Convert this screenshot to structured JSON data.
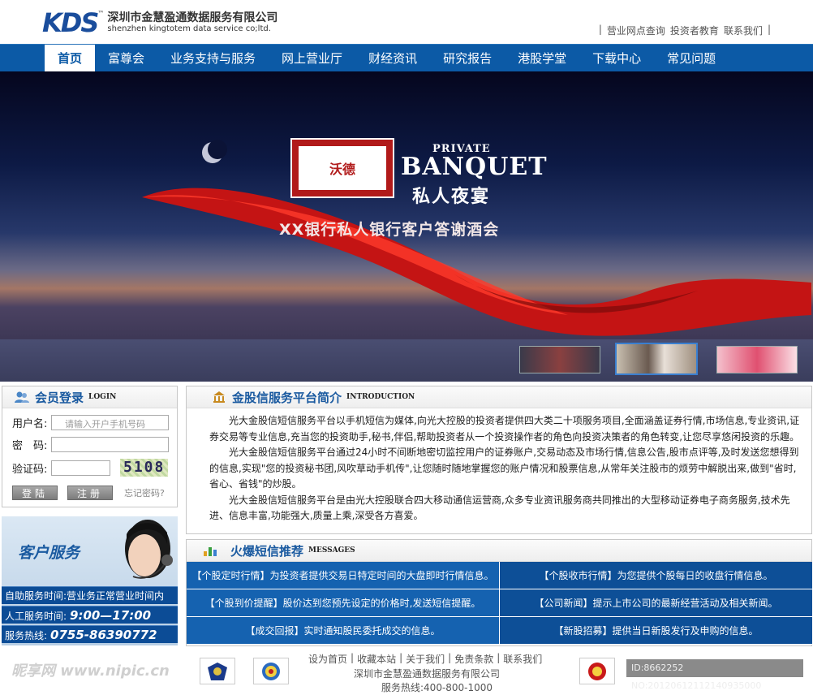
{
  "header": {
    "logo_mark": "KDS",
    "logo_tm": "™",
    "company_cn": "深圳市金慧盈通数据服务有限公司",
    "company_en": "shenzhen kingtotem data service co;ltd.",
    "toplinks": [
      "|",
      "营业网点查询",
      "投资者教育",
      "联系我们",
      "|"
    ]
  },
  "nav": {
    "items": [
      "首页",
      "富尊会",
      "业务支持与服务",
      "网上营业厅",
      "财经资讯",
      "研究报告",
      "港股学堂",
      "下载中心",
      "常见问题"
    ],
    "active_index": 0
  },
  "banner": {
    "brand": "沃德",
    "private": "PRIVATE",
    "banquet": "BANQUET",
    "night": "私人夜宴",
    "slogan": "XX银行私人银行客户答谢酒会"
  },
  "login": {
    "title": "会员登录",
    "title_en": "LOGIN",
    "username_label": "用户名:",
    "username_placeholder": "请输入开户手机号码",
    "password_label": "密　码:",
    "captcha_label": "验证码:",
    "captcha_value": "5108",
    "login_button": "登陆",
    "register_button": "注册",
    "forgot": "忘记密码?"
  },
  "service": {
    "title": "客户服务",
    "hours_label": "自助服务时间:",
    "hours_value": "营业务正常营业时间内",
    "manual_label": "人工服务时间:",
    "manual_value": "9:00—17:00",
    "hotline_label": "服务热线:",
    "hotline_value": "0755-86390772"
  },
  "intro": {
    "title": "金股信服务平台简介",
    "title_en": "INTRODUCTION",
    "paragraphs": [
      "光大金股信短信服务平台以手机短信为媒体,向光大控股的投资者提供四大类二十项服务项目,全面涵盖证券行情,市场信息,专业资讯,证券交易等专业信息,充当您的投资助手,秘书,伴侣,帮助投资者从一个投资操作者的角色向投资决策者的角色转变,让您尽享悠闲投资的乐趣。",
      "光大金股信短信服务平台通过24小时不间断地密切监控用户的证券账户,交易动态及市场行情,信息公告,股市点评等,及时发送您想得到的信息,实现\"您的投资秘书团,风吹草动手机传\",让您随时随地掌握您的账户情况和股票信息,从常年关注股市的烦劳中解脱出来,做到\"省时,省心、省钱\"的炒股。",
      "光大金股信短信服务平台是由光大控股联合四大移动通信运营商,众多专业资讯服务商共同推出的大型移动证券电子商务服务,技术先进、信息丰富,功能强大,质量上乘,深受各方喜爱。"
    ]
  },
  "messages": {
    "title": "火爆短信推荐",
    "title_en": "MESSAGES",
    "items": [
      "【个股定时行情】为投资者提供交易日特定时间的大盘即时行情信息。",
      "【个股收市行情】为您提供个股每日的收盘行情信息。",
      "【个股到价提醒】股价达到您预先设定的价格时,发送短信提醒。",
      "【公司新闻】提示上市公司的最新经营活动及相关新闻。",
      "【成交回报】实时通知股民委托成交的信息。",
      "【新股招募】提供当日新股发行及申购的信息。"
    ]
  },
  "footer": {
    "links": [
      "设为首页",
      "|",
      "收藏本站",
      "|",
      "关于我们",
      "|",
      "免责条款",
      "|",
      "联系我们"
    ],
    "company": "深圳市金慧盈通数据服务有限公司",
    "hotline": "服务热线:400-800-1000"
  },
  "watermark": "昵享网 www.nipic.cn",
  "image_id": "ID:8662252 NO:20120612112140935000"
}
